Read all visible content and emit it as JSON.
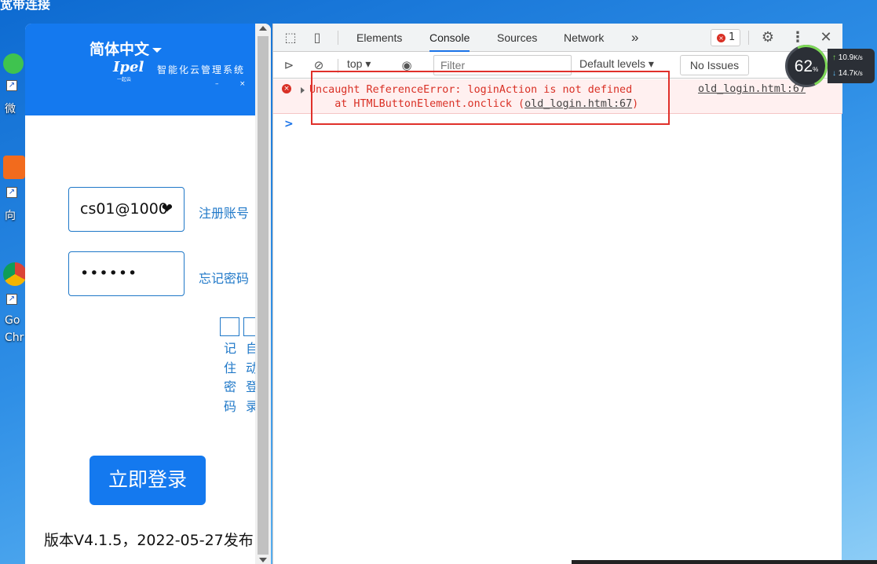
{
  "desktop": {
    "top_text": "宽带连接",
    "labels": {
      "wechat": "微",
      "video": "向",
      "chrome_line1": "Go",
      "chrome_line2": "Chr"
    }
  },
  "login": {
    "language": "简体中文",
    "logo": "Ipel",
    "logo_sub": "一起云",
    "slogan": "智能化云管理系统",
    "minimize": "–",
    "close": "×",
    "account_value": "cs01@1000",
    "password_value": "••••••",
    "register_link": "注册账号",
    "forgot_link": "忘记密码",
    "remember_label": "记住密码",
    "auto_label": "自动登录",
    "login_button": "立即登录",
    "version_text": "版本V4.1.5，2022-05-27发布"
  },
  "devtools": {
    "tabs": [
      "Elements",
      "Console",
      "Sources",
      "Network"
    ],
    "active_tab": "Console",
    "more_tabs": "»",
    "error_count": "1",
    "context": "top",
    "filter_placeholder": "Filter",
    "levels": "Default levels",
    "issues": "No Issues",
    "error_line1": "Uncaught ReferenceError: loginAction is not defined",
    "error_line2_prefix": "    at HTMLButtonElement.onclick (",
    "error_line2_link": "old_login.html:67",
    "error_line2_suffix": ")",
    "error_source": "old_login.html:67",
    "prompt": ">"
  },
  "net_monitor": {
    "percent": "62",
    "percent_unit": "%",
    "upload": "10.9",
    "download": "14.7",
    "unit": "K/s"
  },
  "colors": {
    "brand_blue": "#1479ef",
    "link_blue": "#1f78c8",
    "error_red": "#d93025",
    "highlight_box": "#e0302a"
  }
}
